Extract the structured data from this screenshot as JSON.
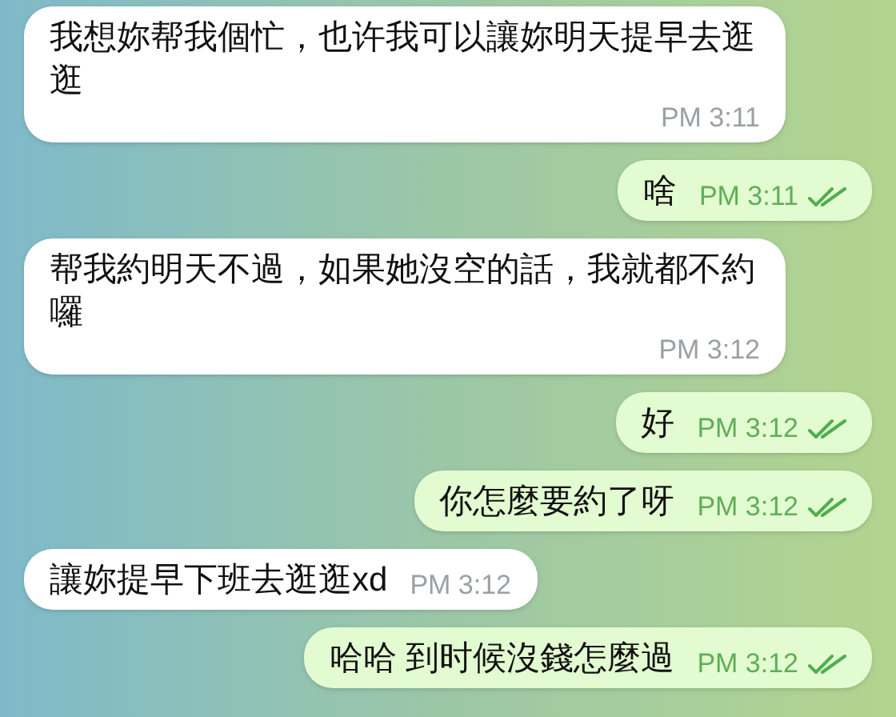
{
  "messages": [
    {
      "kind": "incoming",
      "text": "我想妳帮我個忙，也许我可以讓妳明天提早去逛逛",
      "time": "PM 3:11"
    },
    {
      "kind": "outgoing",
      "text": "啥",
      "time": "PM 3:11",
      "read": true
    },
    {
      "kind": "incoming",
      "text": "帮我約明天不過，如果她沒空的話，我就都不約囉",
      "time": "PM 3:12"
    },
    {
      "kind": "outgoing",
      "text": "好",
      "time": "PM 3:12",
      "read": true
    },
    {
      "kind": "outgoing",
      "text": "你怎麼要約了呀",
      "time": "PM 3:12",
      "read": true
    },
    {
      "kind": "incoming",
      "text": "讓妳提早下班去逛逛xd",
      "time": "PM 3:12"
    },
    {
      "kind": "outgoing",
      "text": "哈哈 到时候沒錢怎麼過",
      "time": "PM 3:12",
      "read": true
    }
  ]
}
